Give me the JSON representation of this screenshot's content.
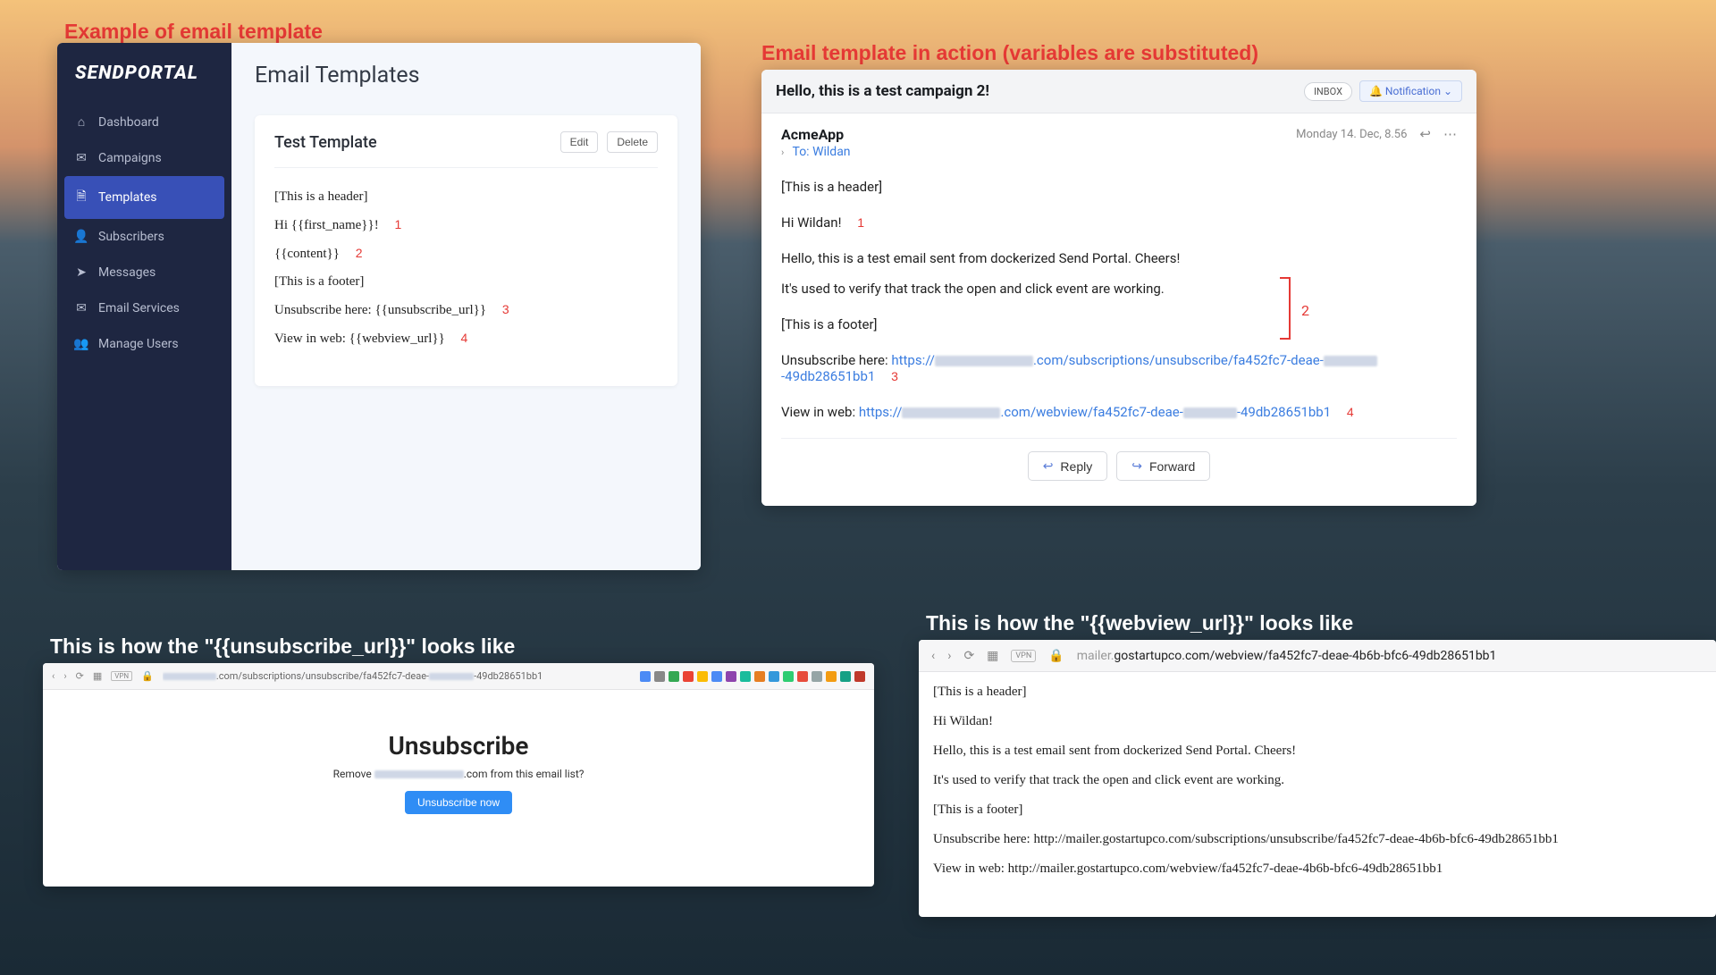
{
  "captions": {
    "panel1": "Example of email template",
    "panel2": "Email template in action (variables are substituted)",
    "panel3": "This is how the \"{{unsubscribe_url}}\" looks like",
    "panel4": "This is how the \"{{webview_url}}\" looks like"
  },
  "sendportal": {
    "logo": "SENDPORTAL",
    "nav": {
      "dashboard": "Dashboard",
      "campaigns": "Campaigns",
      "templates": "Templates",
      "subscribers": "Subscribers",
      "messages": "Messages",
      "emailServices": "Email Services",
      "manageUsers": "Manage Users"
    },
    "pageTitle": "Email Templates",
    "card": {
      "title": "Test Template",
      "editBtn": "Edit",
      "deleteBtn": "Delete",
      "lines": {
        "header": "[This is a header]",
        "greeting": "Hi {{first_name}}!",
        "content": "{{content}}",
        "footer": "[This is a footer]",
        "unsub": "Unsubscribe here: {{unsubscribe_url}}",
        "webview": "View in web: {{webview_url}}"
      },
      "nums": {
        "n1": "1",
        "n2": "2",
        "n3": "3",
        "n4": "4"
      }
    }
  },
  "mailclient": {
    "subject": "Hello, this is a test campaign 2!",
    "inbox": "INBOX",
    "notif": "Notification",
    "from": "AcmeApp",
    "toLabel": "To:",
    "toName": "Wildan",
    "date": "Monday 14. Dec, 8.56",
    "lines": {
      "header": "[This is a header]",
      "greeting": "Hi Wildan!",
      "body1": "Hello, this is a test email sent from dockerized Send Portal. Cheers!",
      "body2": "It's used to verify that track the open and click event are working.",
      "footer": "[This is a footer]",
      "unsubLabel": "Unsubscribe here: ",
      "unsubUrlPre": "https://",
      "unsubUrlMid": ".com/subscriptions/unsubscribe/fa452fc7-deae-",
      "unsubUrlSuf": "-49db28651bb1",
      "webLabel": "View in web: ",
      "webUrlPre": "https://",
      "webUrlMid": ".com/webview/fa452fc7-deae-",
      "webUrlSuf": "-49db28651bb1"
    },
    "nums": {
      "n1": "1",
      "n2": "2",
      "n3": "3",
      "n4": "4"
    },
    "reply": "Reply",
    "forward": "Forward"
  },
  "unsubBrowser": {
    "urlPrefix": ".com/subscriptions/unsubscribe/fa452fc7-deae-",
    "urlSuffix": "-49db28651bb1",
    "title": "Unsubscribe",
    "subPrefix": "Remove ",
    "subSuffix": ".com from this email list?",
    "btn": "Unsubscribe now"
  },
  "webviewBrowser": {
    "vpn": "VPN",
    "urlGray": "mailer.",
    "url": "gostartupco.com/webview/fa452fc7-deae-4b6b-bfc6-49db28651bb1",
    "lines": {
      "header": "[This is a header]",
      "greeting": "Hi Wildan!",
      "body1": "Hello, this is a test email sent from dockerized Send Portal. Cheers!",
      "body2": "It's used to verify that track the open and click event are working.",
      "footer": "[This is a footer]",
      "unsub": "Unsubscribe here: http://mailer.gostartupco.com/subscriptions/unsubscribe/fa452fc7-deae-4b6b-bfc6-49db28651bb1",
      "webview": "View in web: http://mailer.gostartupco.com/webview/fa452fc7-deae-4b6b-bfc6-49db28651bb1"
    }
  }
}
